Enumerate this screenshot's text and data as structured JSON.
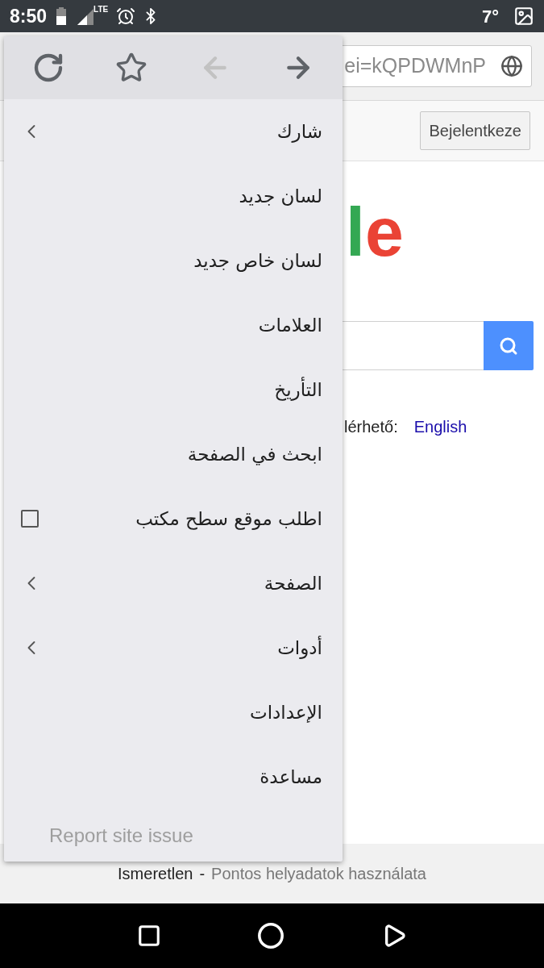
{
  "status_bar": {
    "time": "8:50",
    "network": "LTE",
    "temperature": "7°"
  },
  "browser": {
    "url": "ei=kQPDWMnP"
  },
  "page": {
    "sign_in": "Bejelentkeze",
    "logo": "le",
    "languages_label": "lérhető:",
    "language_link": "English"
  },
  "footer": {
    "location": "Ismeretlen",
    "separator": "-",
    "link": "Pontos helyadatok használata"
  },
  "menu": {
    "toolbar": [
      {
        "kind": "reload",
        "disabled": false
      },
      {
        "kind": "bookmark",
        "disabled": false
      },
      {
        "kind": "back",
        "disabled": true
      },
      {
        "kind": "forward",
        "disabled": false
      }
    ],
    "items": [
      {
        "kind": "submenu",
        "label": "شارك"
      },
      {
        "kind": "plain",
        "label": "لسان جديد"
      },
      {
        "kind": "plain",
        "label": "لسان خاص جديد"
      },
      {
        "kind": "plain",
        "label": "العلامات"
      },
      {
        "kind": "plain",
        "label": "التأريخ"
      },
      {
        "kind": "plain",
        "label": "ابحث في الصفحة"
      },
      {
        "kind": "checkbox",
        "label": "اطلب موقع سطح مكتب",
        "checked": false
      },
      {
        "kind": "submenu",
        "label": "الصفحة"
      },
      {
        "kind": "submenu",
        "label": "أدوات"
      },
      {
        "kind": "plain",
        "label": "الإعدادات"
      },
      {
        "kind": "plain",
        "label": "مساعدة"
      }
    ],
    "footer_link": "Report site issue"
  }
}
